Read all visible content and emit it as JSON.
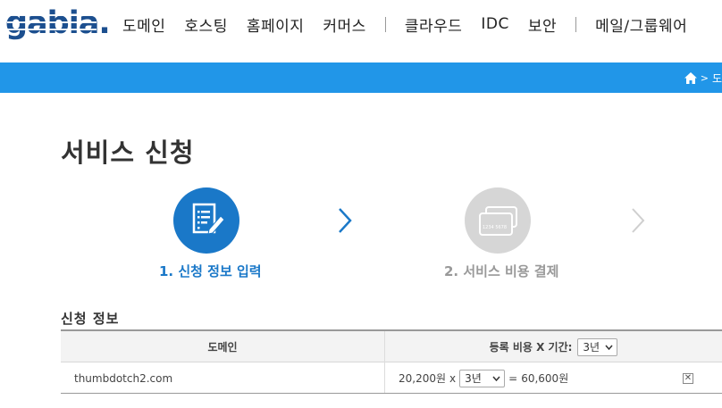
{
  "header": {
    "logo_text": "gabia.",
    "nav": [
      {
        "label": "도메인"
      },
      {
        "label": "호스팅"
      },
      {
        "label": "홈페이지"
      },
      {
        "label": "커머스"
      },
      {
        "label": "클라우드"
      },
      {
        "label": "IDC"
      },
      {
        "label": "보안"
      },
      {
        "label": "메일/그룹웨어"
      }
    ]
  },
  "breadcrumb": {
    "current": "도"
  },
  "page": {
    "title": "서비스 신청"
  },
  "steps": [
    {
      "label": "1. 신청 정보 입력",
      "active": true
    },
    {
      "label": "2. 서비스 비용 결제",
      "active": false
    }
  ],
  "card_text": "1234 5678",
  "section": {
    "title": "신청 정보"
  },
  "table": {
    "col_domain": "도메인",
    "col_price": "등록 비용 X 기간:",
    "period_select": "3년",
    "rows": [
      {
        "domain": "thumbdotch2.com",
        "unit_price": "20,200원",
        "times": "x",
        "period": "3년",
        "equals": "=",
        "total": "60,600원",
        "delete_glyph": "✕"
      }
    ]
  },
  "colors": {
    "brand_blue": "#2196e8",
    "step_active": "#1a78c8",
    "step_inactive": "#d6d6d6",
    "text_inactive": "#999999"
  }
}
